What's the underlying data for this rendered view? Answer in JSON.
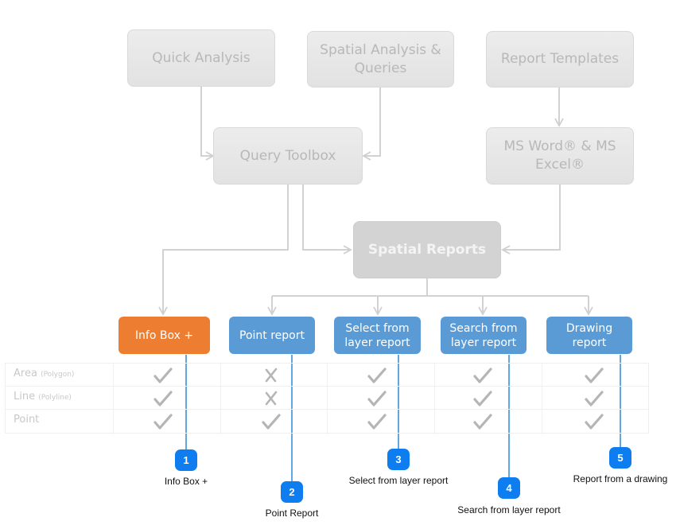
{
  "diagram": {
    "top_boxes": {
      "quick_analysis": "Quick Analysis",
      "spatial_analysis": "Spatial Analysis & Queries",
      "report_templates": "Report Templates"
    },
    "mid_boxes": {
      "query_toolbox": "Query Toolbox",
      "ms_office": "MS Word® & MS Excel®"
    },
    "center_box": "Spatial Reports",
    "report_types": [
      {
        "label": "Info Box +",
        "style": "orange"
      },
      {
        "label": "Point report",
        "style": "blue"
      },
      {
        "label": "Select from layer report",
        "style": "blue"
      },
      {
        "label": "Search from layer report",
        "style": "blue"
      },
      {
        "label": "Drawing report",
        "style": "blue"
      }
    ],
    "colors": {
      "orange": "#ed7d31",
      "blue": "#5b9bd5",
      "badge_blue": "#0d7df0",
      "callout_line": "#0a78d6",
      "connector_gray": "#cfcfcf"
    }
  },
  "support_table": {
    "rows": [
      {
        "label": "Area",
        "sub": "(Polygon)",
        "support": [
          "check",
          "cross",
          "check",
          "check",
          "check"
        ]
      },
      {
        "label": "Line",
        "sub": "(Polyline)",
        "support": [
          "check",
          "cross",
          "check",
          "check",
          "check"
        ]
      },
      {
        "label": "Point",
        "sub": "",
        "support": [
          "check",
          "check",
          "check",
          "check",
          "check"
        ]
      }
    ]
  },
  "callouts": [
    {
      "number": "1",
      "caption": "Info Box +"
    },
    {
      "number": "2",
      "caption": "Point Report"
    },
    {
      "number": "3",
      "caption": "Select from layer report"
    },
    {
      "number": "4",
      "caption": "Search from layer report"
    },
    {
      "number": "5",
      "caption": "Report from a drawing"
    }
  ]
}
